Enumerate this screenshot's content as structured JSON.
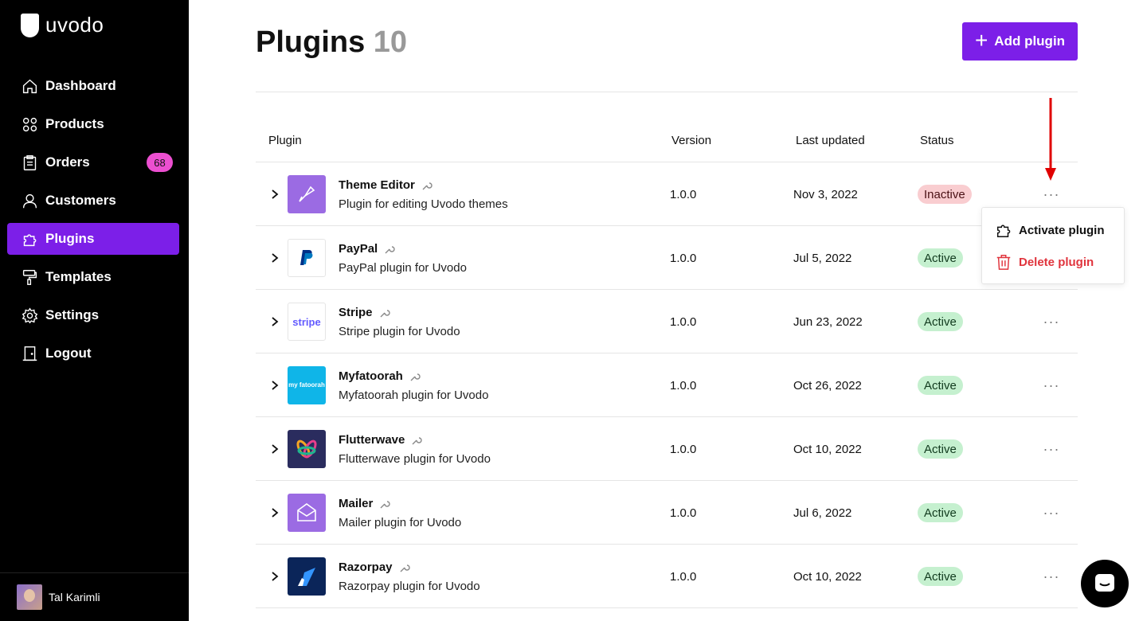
{
  "brand": {
    "name": "uvodo"
  },
  "sidebar": {
    "items": [
      {
        "label": "Dashboard",
        "icon": "home-icon"
      },
      {
        "label": "Products",
        "icon": "grid-icon"
      },
      {
        "label": "Orders",
        "icon": "clipboard-icon",
        "badge": "68"
      },
      {
        "label": "Customers",
        "icon": "user-icon"
      },
      {
        "label": "Plugins",
        "icon": "puzzle-icon",
        "active": true
      },
      {
        "label": "Templates",
        "icon": "paint-roller-icon"
      },
      {
        "label": "Settings",
        "icon": "gear-icon"
      },
      {
        "label": "Logout",
        "icon": "door-icon"
      }
    ],
    "user": {
      "name": "Tal Karimli"
    }
  },
  "header": {
    "title": "Plugins",
    "count": "10",
    "add_button": "Add plugin"
  },
  "table": {
    "columns": {
      "plugin": "Plugin",
      "version": "Version",
      "updated": "Last updated",
      "status": "Status"
    },
    "rows": [
      {
        "name": "Theme Editor",
        "description": "Plugin for editing Uvodo themes",
        "version": "1.0.0",
        "updated": "Nov 3, 2022",
        "status": "Inactive",
        "logo": "theme-editor-logo"
      },
      {
        "name": "PayPal",
        "description": "PayPal plugin for Uvodo",
        "version": "1.0.0",
        "updated": "Jul 5, 2022",
        "status": "Active",
        "logo": "paypal-logo"
      },
      {
        "name": "Stripe",
        "description": "Stripe plugin for Uvodo",
        "version": "1.0.0",
        "updated": "Jun 23, 2022",
        "status": "Active",
        "logo": "stripe-logo",
        "logo_text": "stripe"
      },
      {
        "name": "Myfatoorah",
        "description": "Myfatoorah plugin for Uvodo",
        "version": "1.0.0",
        "updated": "Oct 26, 2022",
        "status": "Active",
        "logo": "myfatoorah-logo",
        "logo_text": "my fatoorah"
      },
      {
        "name": "Flutterwave",
        "description": "Flutterwave plugin for Uvodo",
        "version": "1.0.0",
        "updated": "Oct 10, 2022",
        "status": "Active",
        "logo": "flutterwave-logo"
      },
      {
        "name": "Mailer",
        "description": "Mailer plugin for Uvodo",
        "version": "1.0.0",
        "updated": "Jul 6, 2022",
        "status": "Active",
        "logo": "mailer-logo"
      },
      {
        "name": "Razorpay",
        "description": "Razorpay plugin for Uvodo",
        "version": "1.0.0",
        "updated": "Oct 10, 2022",
        "status": "Active",
        "logo": "razorpay-logo"
      }
    ]
  },
  "context_menu": {
    "activate": "Activate plugin",
    "delete": "Delete plugin"
  },
  "colors": {
    "accent": "#7c1fe8",
    "badge": "#ec4fd0",
    "active_bg": "#c5f0cf",
    "inactive_bg": "#f9cdd0",
    "danger": "#e0343d",
    "annotation_arrow": "#e00000"
  }
}
